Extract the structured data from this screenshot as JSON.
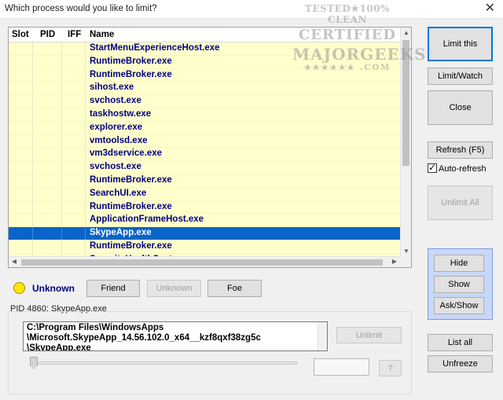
{
  "window": {
    "title": "Which process would you like to limit?",
    "close_glyph": "✕"
  },
  "watermark": {
    "line1": "TESTED★100% CLEAN",
    "line2": "CERTIFIED",
    "line3": "MAJORGEEKS",
    "line4": "★★★★★★ .COM"
  },
  "list": {
    "columns": [
      "Slot",
      "PID",
      "IFF",
      "Name"
    ],
    "rows": [
      {
        "name": "StartMenuExperienceHost.exe"
      },
      {
        "name": "RuntimeBroker.exe"
      },
      {
        "name": "RuntimeBroker.exe"
      },
      {
        "name": "sihost.exe"
      },
      {
        "name": "svchost.exe"
      },
      {
        "name": "taskhostw.exe"
      },
      {
        "name": "explorer.exe"
      },
      {
        "name": "vmtoolsd.exe"
      },
      {
        "name": "vm3dservice.exe"
      },
      {
        "name": "svchost.exe"
      },
      {
        "name": "RuntimeBroker.exe"
      },
      {
        "name": "SearchUI.exe"
      },
      {
        "name": "RuntimeBroker.exe"
      },
      {
        "name": "ApplicationFrameHost.exe"
      },
      {
        "name": "SkypeApp.exe",
        "selected": true
      },
      {
        "name": "RuntimeBroker.exe"
      },
      {
        "name": "SecurityHealthSystray.exe"
      }
    ]
  },
  "status": {
    "label": "Unknown",
    "color": "#ffe600"
  },
  "iff_buttons": {
    "friend": "Friend",
    "unknown": "Unknown",
    "foe": "Foe"
  },
  "process_info": {
    "pid_label": "PID 4860: SkypeApp.exe",
    "path_line1": "C:\\Program Files\\WindowsApps",
    "path_line2": "\\Microsoft.SkypeApp_14.56.102.0_x64__kzf8qxf38zg5c",
    "path_line3": "\\SkypeApp.exe"
  },
  "bottom_buttons": {
    "unlimit": "Unlimit",
    "help": "?"
  },
  "side": {
    "limit_this": "Limit this",
    "limit_watch": "Limit/Watch",
    "close": "Close",
    "refresh": "Refresh (F5)",
    "auto_refresh": "Auto-refresh",
    "auto_refresh_checked": "✓",
    "unlimit_all": "Unlimit All",
    "hide": "Hide",
    "show": "Show",
    "ask_show": "Ask/Show",
    "list_all": "List all",
    "unfreeze": "Unfreeze"
  },
  "colors": {
    "row_bg": "#ffffcc",
    "row_text": "#000080",
    "selected_bg": "#0a64c8",
    "accent": "#0078d7"
  }
}
